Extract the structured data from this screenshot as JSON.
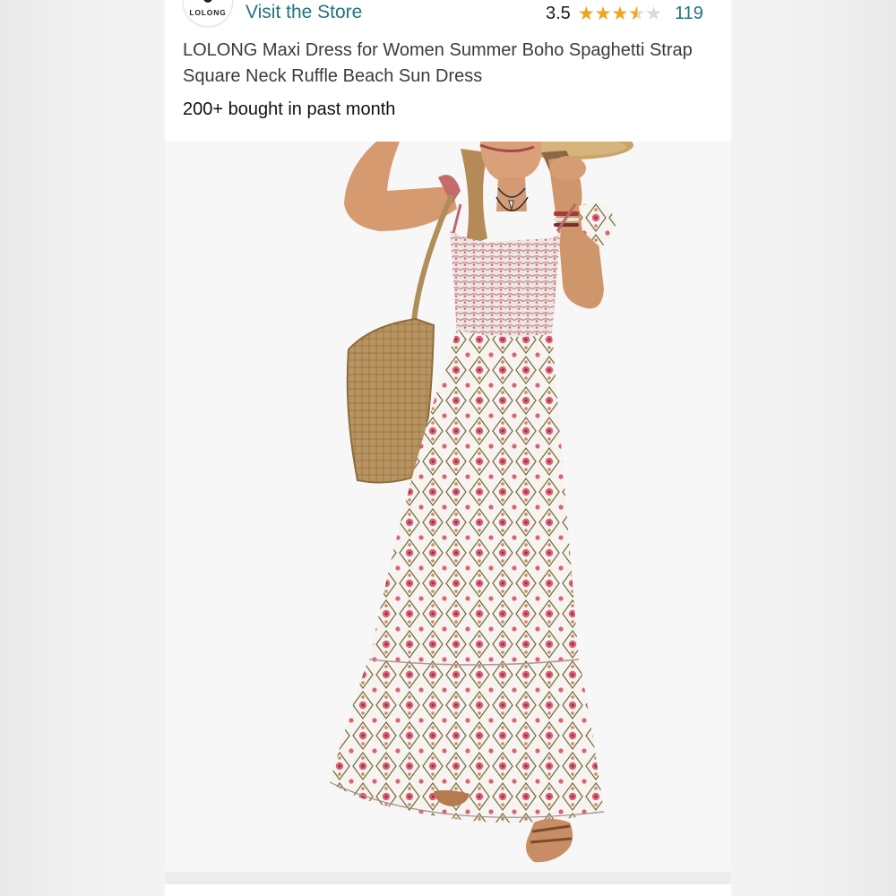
{
  "store": {
    "logo_text": "LOLONG",
    "visit_label": "Visit the Store"
  },
  "rating": {
    "value": "3.5",
    "stars_filled_fraction": 0.7,
    "star_color": "#f3a41b",
    "review_count": "119"
  },
  "product": {
    "title": "LOLONG Maxi Dress for Women Summer Boho Spaghetti Strap Square Neck Ruffle Beach Sun Dress",
    "bought_text": "200+ bought in past month"
  },
  "colors": {
    "link": "#227383",
    "text": "#3b3b3b",
    "pattern_pink": "#d9627a",
    "pattern_red": "#9e2f38",
    "pattern_olive": "#6f6a3c"
  }
}
